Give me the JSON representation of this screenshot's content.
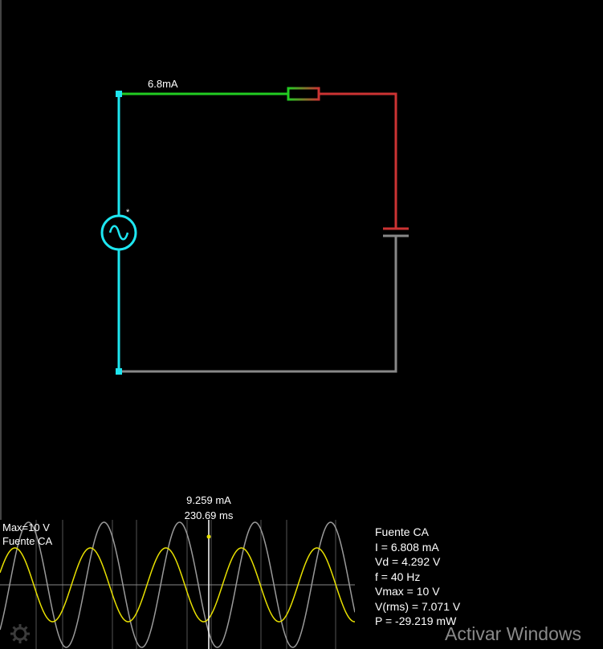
{
  "circuit": {
    "current_label": "6.8mA",
    "source_marker": "*",
    "colors": {
      "source": "#1ee6f0",
      "wire_top": "#22cc22",
      "wire_right": "#cc3333",
      "wire_bottom": "#888888",
      "background": "#000000"
    }
  },
  "scope": {
    "max_label": "Max=10 V",
    "name_label": "Fuente CA",
    "cursor_current": "9.259 mA",
    "cursor_time": "230.69 ms",
    "colors": {
      "voltage": "#9a9a9a",
      "current": "#e8e000",
      "grid": "#555555",
      "background": "#000000"
    },
    "waveform_cycles_visible": 4.7
  },
  "info": {
    "title": "Fuente CA",
    "current": "I = 6.808 mA",
    "vd": "Vd = 4.292 V",
    "frequency": "f = 40 Hz",
    "vmax": "Vmax = 10 V",
    "vrms": "V(rms) = 7.071 V",
    "power": "P = -29.219 mW"
  },
  "watermark": "Activar Windows"
}
